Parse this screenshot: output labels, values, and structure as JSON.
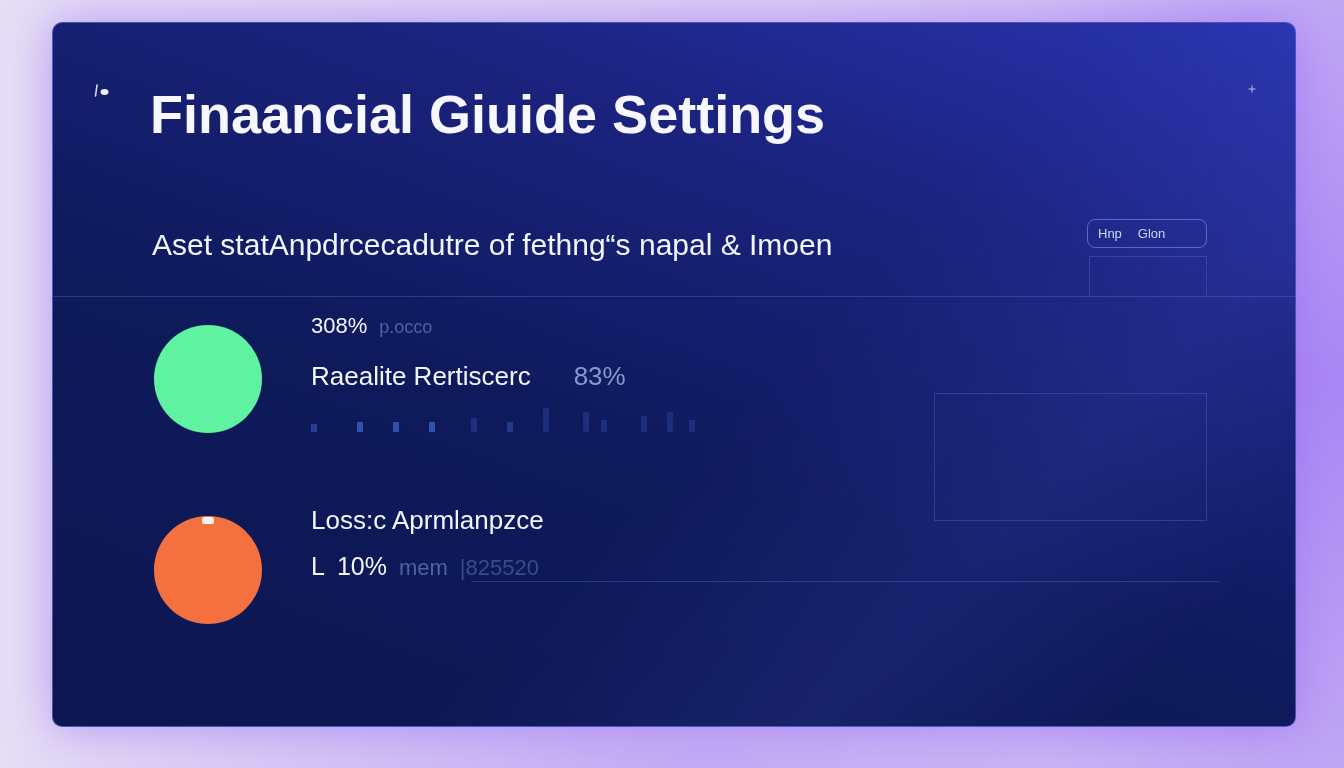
{
  "card": {
    "title": "Finaancial Giuide Settings",
    "subtitle": "Aset statAnpdrcecadutre of fethng“s napal & Imoen",
    "pill_buttons": [
      {
        "label": "Hnp"
      },
      {
        "label": "Glon"
      }
    ]
  },
  "metrics": [
    {
      "color": "#5ff2a0",
      "handle": false,
      "rows": [
        {
          "kind": "caption",
          "parts": [
            {
              "text": "308%",
              "kind": "strong"
            },
            {
              "text": "p.occo",
              "kind": "muted"
            }
          ]
        },
        {
          "kind": "heading",
          "parts": [
            {
              "text": "Raealite Rertiscerc",
              "kind": "strong"
            },
            {
              "text": "83%",
              "kind": "soft"
            }
          ]
        },
        {
          "kind": "sparkline"
        }
      ]
    },
    {
      "color": "#f4703f",
      "handle": true,
      "rows": [
        {
          "kind": "heading",
          "parts": [
            {
              "text": "Loss:c Aprmlanpzce",
              "kind": "strong"
            }
          ]
        },
        {
          "kind": "line",
          "parts": [
            {
              "text": "L",
              "kind": "strong"
            },
            {
              "text": "10%",
              "kind": "strong"
            },
            {
              "text": "mem",
              "kind": "muted"
            },
            {
              "text": "|825520",
              "kind": "faint"
            }
          ]
        }
      ]
    }
  ]
}
